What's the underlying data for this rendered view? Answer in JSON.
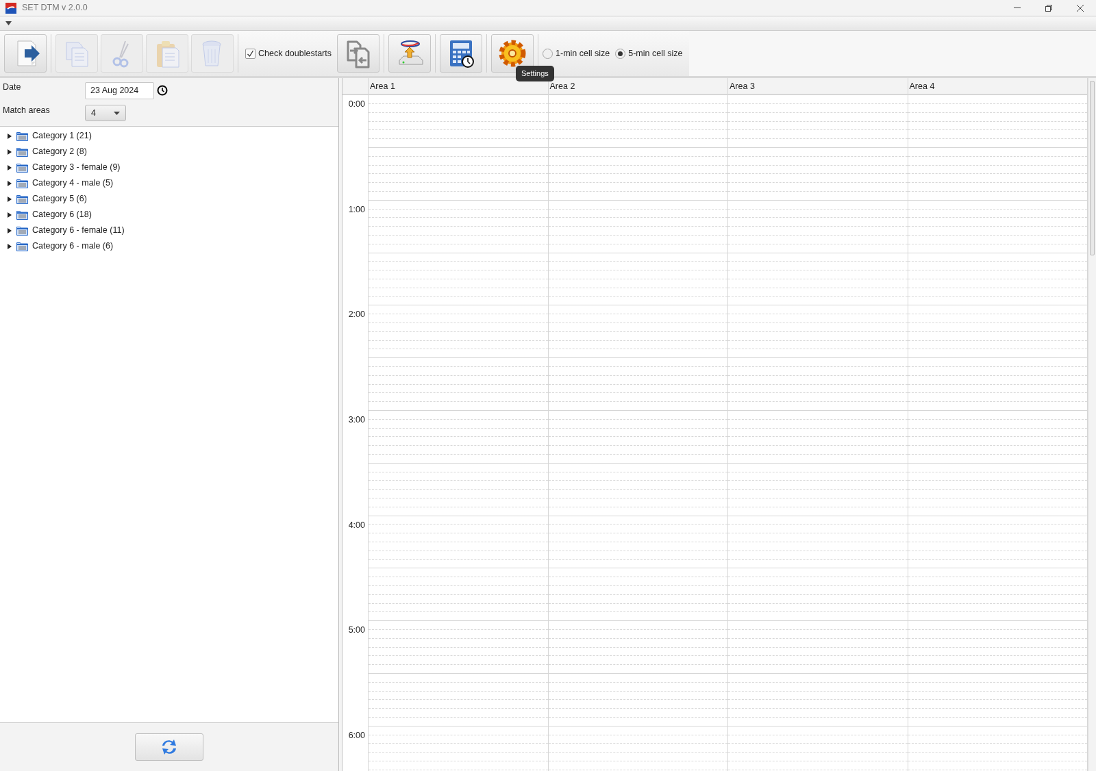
{
  "window": {
    "title": "SET DTM v 2.0.0"
  },
  "toolbar": {
    "groups": [
      [
        {
          "kind": "button",
          "disabled": false
        }
      ],
      [
        {
          "kind": "button",
          "disabled": true
        },
        {
          "kind": "button",
          "disabled": true
        },
        {
          "kind": "button",
          "disabled": true
        },
        {
          "kind": "button",
          "disabled": true
        }
      ],
      [
        {
          "kind": "checkbox",
          "label": "Check doublestarts",
          "checked": true
        },
        {
          "kind": "button",
          "disabled": false
        }
      ],
      [
        {
          "kind": "button",
          "disabled": false
        }
      ],
      [
        {
          "kind": "button",
          "disabled": false
        }
      ],
      [
        {
          "kind": "button",
          "disabled": false,
          "tooltip": "Settings"
        }
      ],
      [
        {
          "kind": "radio",
          "label": "1-min cell size",
          "selected": false
        },
        {
          "kind": "radio",
          "label": "5-min cell size",
          "selected": true
        }
      ]
    ]
  },
  "form": {
    "date_label": "Date",
    "date_value": "23 Aug 2024",
    "areas_label": "Match areas",
    "areas_value": "4"
  },
  "tree": [
    {
      "label": "Category 1 (21)",
      "expanded": false
    },
    {
      "label": "Category 2 (8)",
      "expanded": false
    },
    {
      "label": "Category 3 - female (9)",
      "expanded": false
    },
    {
      "label": "Category 4 - male (5)",
      "expanded": false
    },
    {
      "label": "Category 5 (6)",
      "expanded": false
    },
    {
      "label": "Category 6 (18)",
      "expanded": false
    },
    {
      "label": "Category 6 - female (11)",
      "expanded": false
    },
    {
      "label": "Category 6 - male (6)",
      "expanded": false
    }
  ],
  "schedule": {
    "columns": [
      "Area 1",
      "Area 2",
      "Area 3",
      "Area 4"
    ],
    "hours": [
      "0:00",
      "1:00",
      "2:00",
      "3:00",
      "4:00",
      "5:00",
      "6:00"
    ]
  }
}
